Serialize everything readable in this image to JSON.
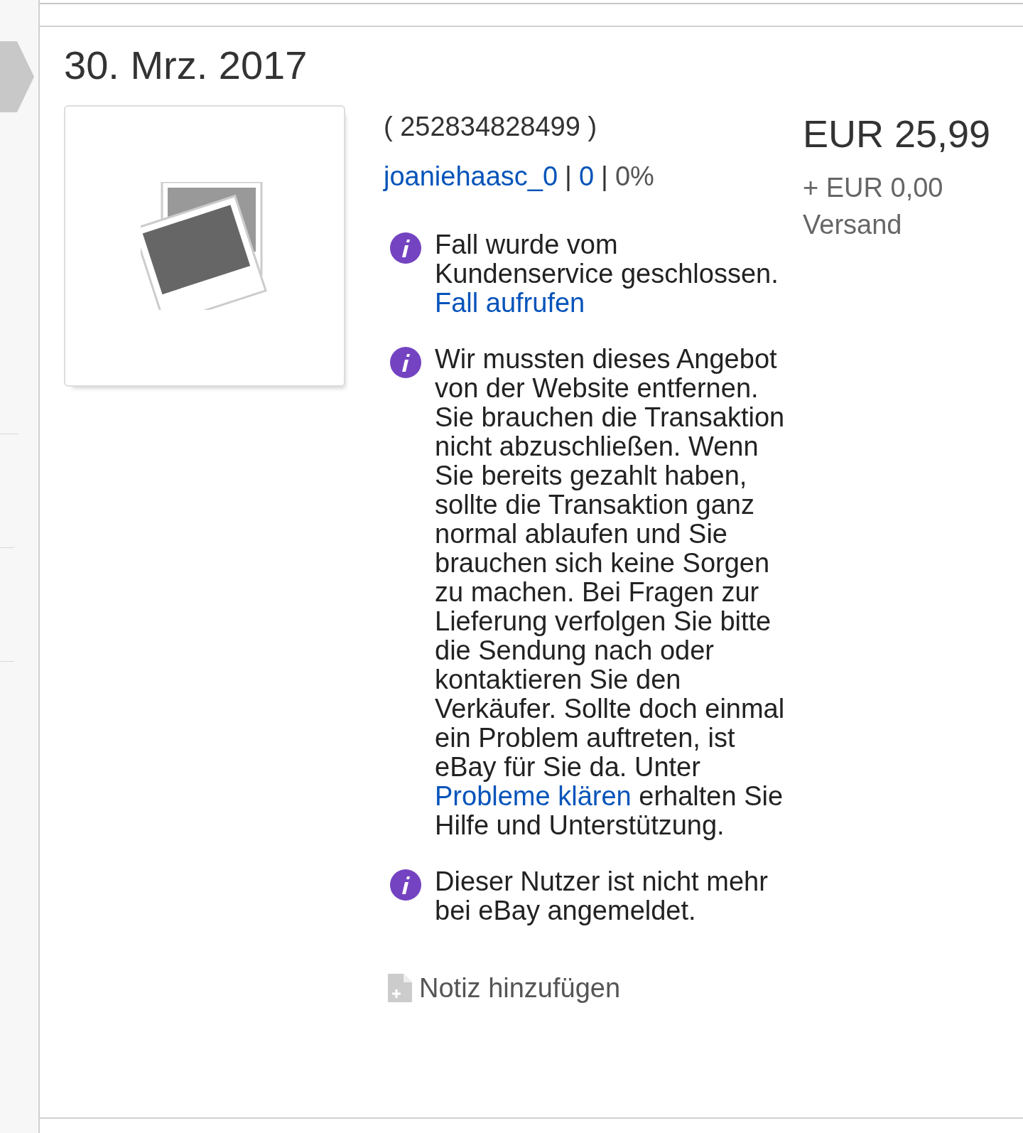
{
  "order": {
    "date": "30. Mrz. 2017",
    "item_number": "( 252834828499 )",
    "seller": [
      {
        "kind": "link",
        "text": "joaniehaasc_0"
      },
      {
        "kind": "sep",
        "text": "|"
      },
      {
        "kind": "link",
        "text": "0"
      },
      {
        "kind": "sep",
        "text": "|"
      },
      {
        "kind": "text",
        "text": "0%"
      }
    ],
    "messages": [
      {
        "parts": [
          {
            "kind": "text",
            "text": "Fall wurde vom Kundenservice geschlossen."
          },
          {
            "kind": "link",
            "text": "Fall aufrufen"
          }
        ]
      },
      {
        "parts": [
          {
            "kind": "text",
            "text": "Wir mussten dieses Angebot von der Website entfernen. Sie brauchen die Transaktion nicht abzuschließen. Wenn Sie bereits gezahlt haben, sollte die Transaktion ganz normal ablaufen und Sie brauchen sich keine Sorgen zu machen. Bei Fragen zur Lieferung verfolgen Sie bitte die Sendung nach oder kontaktieren Sie den Verkäufer. Sollte doch einmal ein Problem auftreten, ist eBay für Sie da. Unter"
          },
          {
            "kind": "link",
            "text": "Probleme klären"
          },
          {
            "kind": "text",
            "text": "erhalten Sie Hilfe und Unterstützung."
          }
        ]
      },
      {
        "parts": [
          {
            "kind": "text",
            "text": "Dieser Nutzer ist nicht mehr bei eBay angemeldet."
          }
        ]
      }
    ],
    "price": "EUR 25,99",
    "shipping": "+ EUR 0,00 Versand",
    "note_action": "Notiz hinzufügen"
  }
}
